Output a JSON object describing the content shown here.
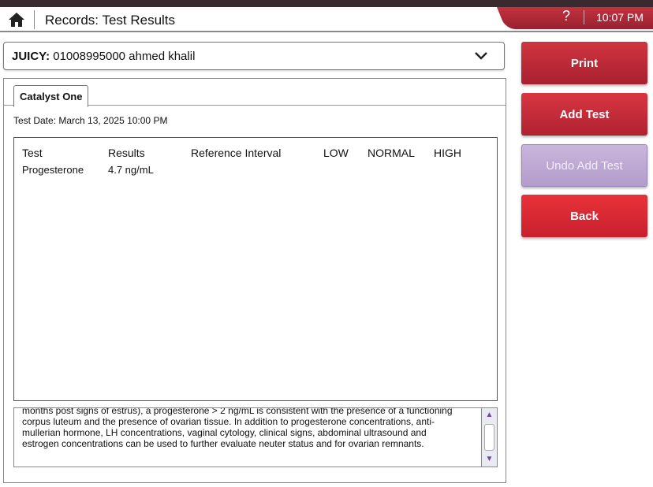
{
  "header": {
    "title": "Records: Test Results",
    "help_label": "?",
    "time": "10:07 PM"
  },
  "patient": {
    "label": "JUICY",
    "separator": ":",
    "value": "01008995000 ahmed khalil"
  },
  "tabs": [
    {
      "label": "Catalyst One"
    }
  ],
  "test_date": "Test Date: March 13, 2025 10:00 PM",
  "results_table": {
    "columns": [
      "Test",
      "Results",
      "Reference Interval",
      "LOW",
      "NORMAL",
      "HIGH"
    ],
    "rows": [
      {
        "test": "Progesterone",
        "result": "4.7 ng/mL",
        "reference": "",
        "low": "",
        "normal": "",
        "high": ""
      }
    ]
  },
  "notes": {
    "line_partial": "months post signs of estrus), a progesterone > 2 ng/mL is consistent with the presence of a functioning",
    "line1": "corpus luteum and the presence of ovarian tissue. In addition to progesterone concentrations, anti-",
    "line2": "mullerian hormone, LH concentrations, vaginal cytology, clinical signs, abdominal ultrasound and",
    "line3": "estrogen concentrations can be used to further evaluate neuter status and for ovarian remnants."
  },
  "actions": {
    "print": "Print",
    "add_test": "Add Test",
    "undo_add_test": "Undo Add Test",
    "back": "Back"
  },
  "colors": {
    "accent_red": "#c8202e",
    "disabled_purple": "#b39ccb"
  },
  "icons": {
    "home": "home-icon",
    "chevron": "chevron-down-icon"
  }
}
